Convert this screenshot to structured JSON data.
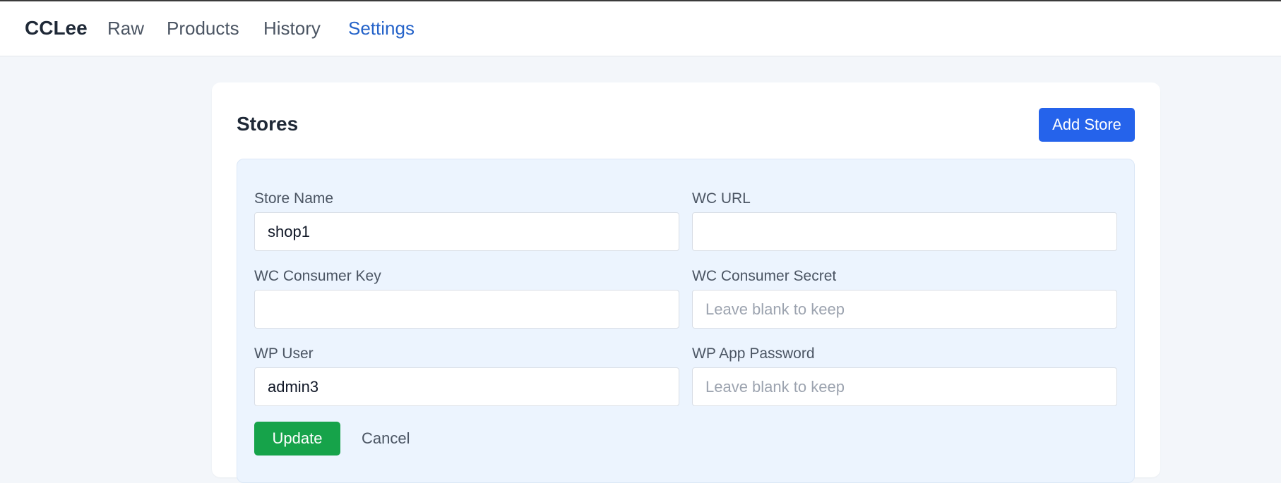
{
  "nav": {
    "brand": "CCLee",
    "links": [
      {
        "label": "Raw"
      },
      {
        "label": "Products"
      },
      {
        "label": "History"
      },
      {
        "label": "Settings",
        "active": true
      }
    ]
  },
  "stores": {
    "title": "Stores",
    "add_button": "Add Store",
    "form": {
      "store_name": {
        "label": "Store Name",
        "value": "shop1",
        "placeholder": ""
      },
      "wc_url": {
        "label": "WC URL",
        "value": "",
        "placeholder": ""
      },
      "wc_consumer_key": {
        "label": "WC Consumer Key",
        "value": "",
        "placeholder": ""
      },
      "wc_consumer_secret": {
        "label": "WC Consumer Secret",
        "value": "",
        "placeholder": "Leave blank to keep"
      },
      "wp_user": {
        "label": "WP User",
        "value": "admin3",
        "placeholder": ""
      },
      "wp_app_password": {
        "label": "WP App Password",
        "value": "",
        "placeholder": "Leave blank to keep"
      },
      "update_button": "Update",
      "cancel_button": "Cancel"
    }
  },
  "colors": {
    "accent": "#2563eb",
    "active_nav": "#2563c9",
    "success": "#16a34a",
    "form_panel_bg": "#ecf4fe",
    "page_bg": "#f3f6fa"
  }
}
